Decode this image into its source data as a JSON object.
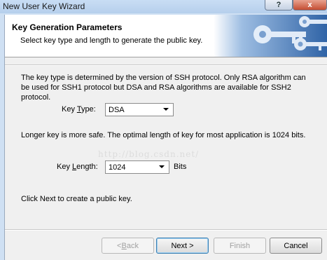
{
  "window": {
    "title": "New User Key Wizard",
    "help_glyph": "?",
    "close_glyph": "x"
  },
  "header": {
    "title": "Key Generation Parameters",
    "subtitle": "Select key type and length to generate the public key."
  },
  "description": "The key type is determined by the version of SSH protocol. Only RSA algorithm can be used for SSH1 protocol but DSA and RSA algorithms are available for SSH2 protocol.",
  "key_type": {
    "label_pre": "Key ",
    "label_u": "T",
    "label_post": "ype:",
    "value": "DSA"
  },
  "length_note": "Longer key is more safe. The optimal length of key for most application is 1024 bits.",
  "watermark": "http://blog.csdn.net/",
  "key_length": {
    "label_pre": "Key ",
    "label_u": "L",
    "label_post": "ength:",
    "value": "1024",
    "unit": "Bits"
  },
  "next_hint": "Click Next to create a public key.",
  "buttons": {
    "back_pre": "< ",
    "back_u": "B",
    "back_post": "ack",
    "next": "Next >",
    "finish": "Finish",
    "cancel": "Cancel"
  },
  "colors": {
    "art_blue": "#3e76b8",
    "key_white": "#e9f1fb"
  }
}
